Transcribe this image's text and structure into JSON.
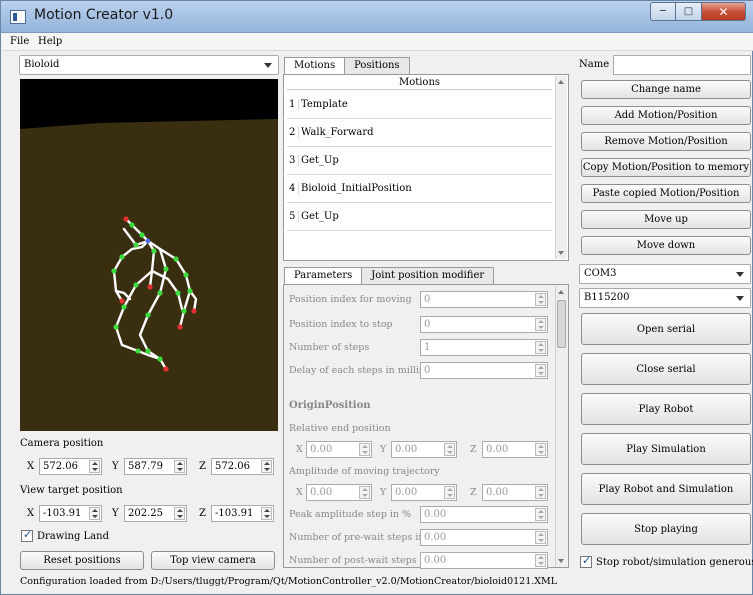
{
  "window": {
    "title": "Motion Creator v1.0",
    "btn_min": "─",
    "btn_max": "□",
    "btn_close": "✕"
  },
  "menu": {
    "file": "File",
    "help": "Help"
  },
  "robot_select": {
    "value": "Bioloid"
  },
  "camera": {
    "camera_position_label": "Camera position",
    "view_target_label": "View target position",
    "pos": {
      "x_label": "X",
      "x": "572.06",
      "y_label": "Y",
      "y": "587.79",
      "z_label": "Z",
      "z": "572.06"
    },
    "target": {
      "x_label": "X",
      "x": "-103.91",
      "y_label": "Y",
      "y": "202.25",
      "z_label": "Z",
      "z": "-103.91"
    },
    "drawing_land_label": "Drawing Land",
    "drawing_land_checked": true,
    "reset_button": "Reset positions",
    "top_view_button": "Top view camera"
  },
  "motions_tabs": [
    {
      "label": "Motions"
    },
    {
      "label": "Positions"
    }
  ],
  "motions_table": {
    "header": "Motions",
    "rows": [
      {
        "num": "1",
        "name": "Template"
      },
      {
        "num": "2",
        "name": "Walk_Forward"
      },
      {
        "num": "3",
        "name": "Get_Up"
      },
      {
        "num": "4",
        "name": "Bioloid_InitialPosition"
      },
      {
        "num": "5",
        "name": "Get_Up"
      }
    ]
  },
  "param_tabs": [
    {
      "label": "Parameters"
    },
    {
      "label": "Joint position modifier"
    }
  ],
  "parameters": {
    "index_moving_label": "Position index for moving",
    "index_moving": "0",
    "index_stop_label": "Position index to stop",
    "index_stop": "0",
    "num_steps_label": "Number of steps",
    "num_steps": "1",
    "delay_label": "Delay of each steps in millisecc",
    "delay": "0",
    "origin_title": "OriginPosition",
    "relative_end_label": "Relative end position",
    "rel": {
      "x_label": "X",
      "x": "0.00",
      "y_label": "Y",
      "y": "0.00",
      "z_label": "Z",
      "z": "0.00"
    },
    "amplitude_label": "Amplitude of moving trajectory",
    "amp": {
      "x_label": "X",
      "x": "0.00",
      "y_label": "Y",
      "y": "0.00",
      "z_label": "Z",
      "z": "0.00"
    },
    "peak_label": "Peak amplitude step in %",
    "peak": "0.00",
    "prewait_label": "Number of pre-wait steps in %",
    "prewait": "0.00",
    "postwait_label": "Number of post-wait steps in %",
    "postwait": "0.00"
  },
  "right_panel": {
    "name_label": "Name",
    "name_value": "",
    "change_name": "Change name",
    "add_motion": "Add Motion/Position",
    "remove_motion": "Remove Motion/Position",
    "copy_motion": "Copy Motion/Position to memory",
    "paste_motion": "Paste copied Motion/Position",
    "move_up": "Move up",
    "move_down": "Move down",
    "port": "COM3",
    "baud": "B115200",
    "open_serial": "Open serial",
    "close_serial": "Close serial",
    "play_robot": "Play Robot",
    "play_simulation": "Play Simulation",
    "play_robot_sim": "Play Robot and Simulation",
    "stop_playing": "Stop playing",
    "stop_generously_label": "Stop robot/simulation generously",
    "stop_generously_checked": true
  },
  "status_bar": {
    "text": "Configuration loaded from D:/Users/tluggt/Program/Qt/MotionController_v2.0/MotionCreator/bioloid0121.XML"
  },
  "colors": {
    "viewport_bg": "#000000",
    "ground": "#3a2e10",
    "skeleton": "#ffffff",
    "joint": "#3bdc3b",
    "joint_end": "#e03030"
  }
}
